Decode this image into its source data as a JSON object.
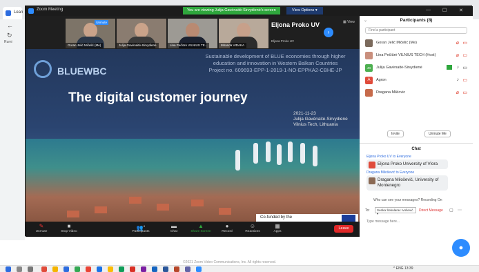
{
  "browser": {
    "tabs": [
      {
        "label": "Lean"
      },
      {
        "label": "Zoom Meeting"
      }
    ],
    "side_label": "Rumi"
  },
  "zoom": {
    "title": "Zoom Meeting",
    "share_banner": "You are viewing Julija Gavėnaitė-Sirvydienė's screen",
    "view_options": "View Options ▾",
    "view_label": "View",
    "videos": [
      {
        "name": "Goran Jelić Mičelić (Me)",
        "unmute_label": "Unmute"
      },
      {
        "name": "Julija Gavėnaitė-Sirvydienė"
      },
      {
        "name": "Lina Pečiūrė VILNIUS TE..."
      },
      {
        "name": "Miranda VIDAKA"
      }
    ],
    "name_tile": "Eljona Proko UV",
    "name_tile_caption": "Eljona Proko UV",
    "slide": {
      "logo": "BLUEWBC",
      "project_lines": [
        "Sustainable development of BLUE economies through higher",
        "education and innovation in Western Balkan Countries",
        "Project no. 609693-EPP-1-2019-1-NO-EPPKA2-CBHE-JP"
      ],
      "title": "The digital customer journey",
      "meta_lines": [
        "2021-11-23",
        "Julija Gavėnaitė-Sirvydienė",
        "Vilnius Tech, Lithuania"
      ],
      "cofunded": "Co-funded by the",
      "cofunded_sub": "Erasmus+ Programme"
    },
    "toolbar": [
      {
        "label": "Unmute",
        "icon": "microphone-muted-icon",
        "glyph": "🎤"
      },
      {
        "label": "Stop Video",
        "icon": "video-camera-icon",
        "glyph": "■"
      },
      {
        "label": "Participants",
        "icon": "participants-icon",
        "glyph": "👥",
        "count": "8"
      },
      {
        "label": "Chat",
        "icon": "chat-icon",
        "glyph": "💬"
      },
      {
        "label": "Share Screen",
        "icon": "share-screen-icon",
        "glyph": "⬆"
      },
      {
        "label": "Record",
        "icon": "record-icon",
        "glyph": "●"
      },
      {
        "label": "Reactions",
        "icon": "reactions-icon",
        "glyph": "☺"
      },
      {
        "label": "Apps",
        "icon": "apps-icon",
        "glyph": "▦"
      }
    ],
    "leave_label": "Leave"
  },
  "participants": {
    "title": "Participants (8)",
    "search_placeholder": "Find a participant",
    "rows": [
      {
        "name": "Goran Jelić Mičelić (Me)",
        "avatar_color": "#7b6a5c",
        "avatar_letter": ""
      },
      {
        "name": "Lina Pečiūrė VILNIUS TECH (Host)",
        "avatar_color": "#c98f7d",
        "avatar_letter": ""
      },
      {
        "name": "Julija Gavėnaitė-Sirvydienė",
        "avatar_color": "#4caf50",
        "avatar_letter": "JG"
      },
      {
        "name": "Agron",
        "avatar_color": "#e04b3b",
        "avatar_letter": "A"
      },
      {
        "name": "Dragana Miklovic",
        "avatar_color": "#c66a4a",
        "avatar_letter": ""
      }
    ],
    "invite_label": "Invite",
    "unmute_me_label": "Unmute Me"
  },
  "chat": {
    "title": "Chat",
    "messages": [
      {
        "sender": "Eljona Proko UV to Everyone",
        "text": "Eljona Proko University of Vlora",
        "avatar_color": "#e04b3b"
      },
      {
        "sender": "Dragana Milošević to Everyone",
        "text": "Dragana Milošević, University of Montenegro",
        "avatar_color": "#8a6a55"
      }
    ],
    "who_can_see": "Who can see your messages? Recording On",
    "to_label": "To:",
    "to_value": "Senka Šekularac Ivošević ▾",
    "direct_message": "Direct Message",
    "input_placeholder": "Type message here..."
  },
  "copyright": "©2021 Zoom Video Communications, Inc. All rights reserved.",
  "taskbar": {
    "tray_text": "^  ENG  13:39",
    "tray_date": "23.11.2021"
  },
  "colors": {
    "accent": "#2d8cff",
    "leave": "#e02828",
    "share_green": "#2fa73d"
  }
}
